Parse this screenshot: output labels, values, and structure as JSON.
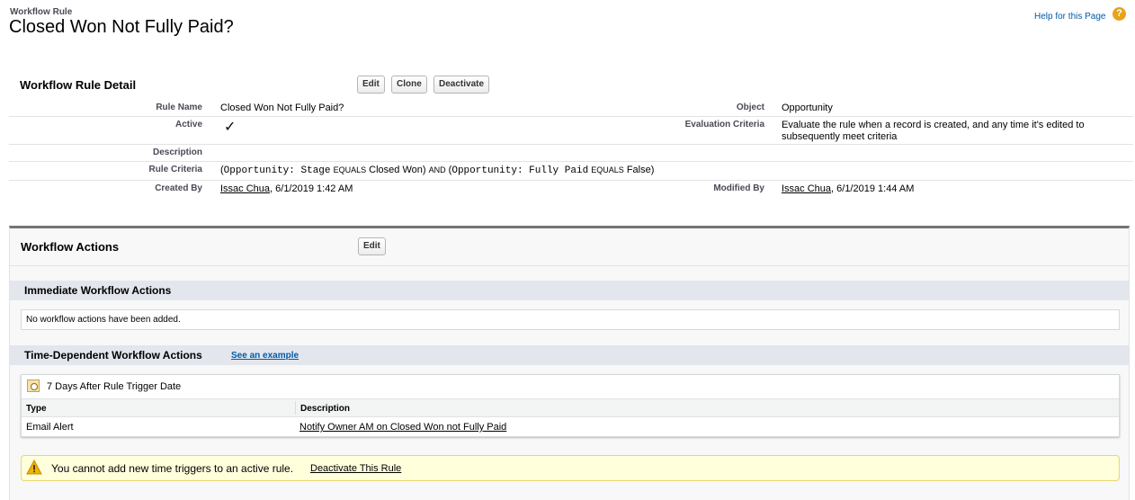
{
  "header": {
    "breadcrumb": "Workflow Rule",
    "title": "Closed Won Not Fully Paid?",
    "help_link": "Help for this Page",
    "help_icon": "question-icon"
  },
  "detail": {
    "section_title": "Workflow Rule Detail",
    "buttons": {
      "edit": "Edit",
      "clone": "Clone",
      "deactivate": "Deactivate"
    },
    "fields": {
      "rule_name_label": "Rule Name",
      "rule_name_value": "Closed Won Not Fully Paid?",
      "object_label": "Object",
      "object_value": "Opportunity",
      "active_label": "Active",
      "active_checked": true,
      "evaluation_label": "Evaluation Criteria",
      "evaluation_value_line1": "Evaluate the rule when a record is created, and any time it's edited to",
      "evaluation_value_line2": "subsequently meet criteria",
      "description_label": "Description",
      "description_value": "",
      "criteria_label": "Rule Criteria",
      "criteria": {
        "open1": "(",
        "field1": "Opportunity: Stage",
        "op1": "EQUALS",
        "val1": "Closed Won)",
        "and": "AND",
        "open2": "(",
        "field2": "Opportunity: Fully Paid",
        "op2": "EQUALS",
        "val2": "False)"
      },
      "created_by_label": "Created By",
      "created_by_name": "Issac Chua",
      "created_by_date": ", 6/1/2019 1:42 AM",
      "modified_by_label": "Modified By",
      "modified_by_name": "Issac Chua",
      "modified_by_date": ", 6/1/2019 1:44 AM"
    }
  },
  "actions": {
    "section_title": "Workflow Actions",
    "edit_button": "Edit",
    "immediate": {
      "title": "Immediate Workflow Actions",
      "empty_text": "No workflow actions have been added."
    },
    "time_dependent": {
      "title": "Time-Dependent Workflow Actions",
      "example_link": "See an example",
      "trigger_title": "7 Days After Rule Trigger Date",
      "trigger_icon": "calendar-clock-icon",
      "columns": [
        "Type",
        "Description"
      ],
      "rows": [
        {
          "type": "Email Alert",
          "description": "Notify Owner AM on Closed Won not Fully Paid"
        }
      ]
    },
    "warning": {
      "icon": "warning-icon",
      "text": "You cannot add new time triggers to an active rule.",
      "link": "Deactivate This Rule"
    }
  },
  "colors": {
    "section_header_bg": "#e3e6ed",
    "warning_bg": "#ffffdc",
    "warning_border": "#e8d870",
    "help_icon": "#e8a31c",
    "link_blue": "#015ba7"
  }
}
